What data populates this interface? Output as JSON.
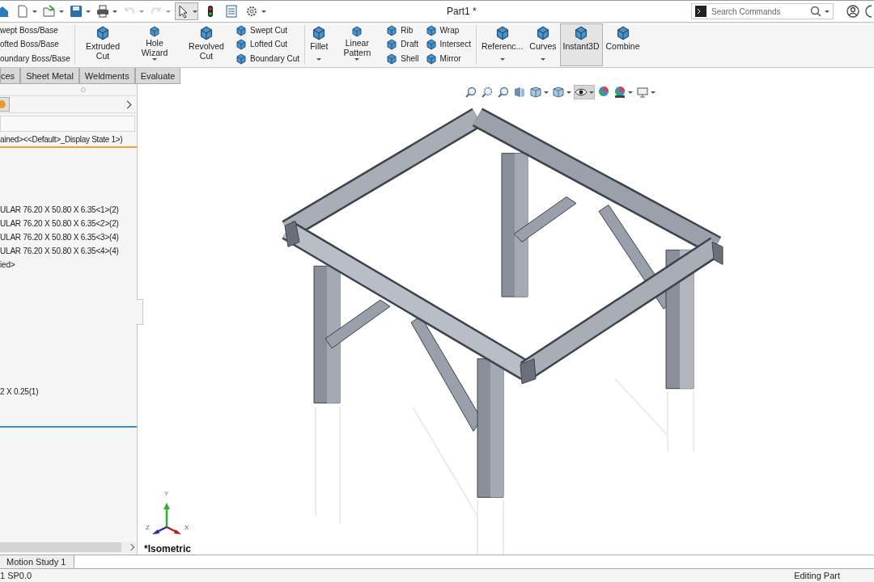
{
  "window": {
    "title": "Part1 *"
  },
  "quick_access": [
    {
      "kind": "home",
      "dropdown": false,
      "disabled": false,
      "selected": false
    },
    {
      "kind": "new",
      "dropdown": true,
      "disabled": false,
      "selected": false
    },
    {
      "kind": "open",
      "dropdown": true,
      "disabled": false,
      "selected": false
    },
    {
      "kind": "save",
      "dropdown": true,
      "disabled": false,
      "selected": false
    },
    {
      "kind": "print",
      "dropdown": true,
      "disabled": false,
      "selected": false
    },
    {
      "kind": "undo",
      "dropdown": true,
      "disabled": true,
      "selected": false
    },
    {
      "kind": "redo",
      "dropdown": true,
      "disabled": true,
      "selected": false
    },
    {
      "kind": "select",
      "dropdown": true,
      "disabled": false,
      "selected": true
    },
    {
      "kind": "rebuild",
      "dropdown": false,
      "disabled": false,
      "selected": false
    },
    {
      "kind": "properties",
      "dropdown": false,
      "disabled": false,
      "selected": false
    },
    {
      "kind": "options",
      "dropdown": true,
      "disabled": false,
      "selected": false
    }
  ],
  "search": {
    "placeholder": "Search Commands"
  },
  "ribbon": [
    {
      "kind": "stack",
      "items": [
        {
          "label": "wept Boss/Base",
          "icon": false
        },
        {
          "label": "ofted Boss/Base",
          "icon": false
        },
        {
          "label": "oundary Boss/Base",
          "icon": false
        }
      ]
    },
    {
      "kind": "separator"
    },
    {
      "kind": "large",
      "label": "Extruded Cut",
      "dropdown": false,
      "selected": false
    },
    {
      "kind": "large",
      "label": "Hole Wizard",
      "dropdown": true,
      "selected": false
    },
    {
      "kind": "large",
      "label": "Revolved Cut",
      "dropdown": false,
      "selected": false
    },
    {
      "kind": "stack",
      "items": [
        {
          "label": "Swept Cut",
          "icon": true
        },
        {
          "label": "Lofted Cut",
          "icon": true
        },
        {
          "label": "Boundary Cut",
          "icon": true
        }
      ]
    },
    {
      "kind": "separator"
    },
    {
      "kind": "large",
      "label": "Fillet",
      "dropdown": true,
      "selected": false
    },
    {
      "kind": "large",
      "label": "Linear Pattern",
      "dropdown": true,
      "selected": false
    },
    {
      "kind": "stack",
      "items": [
        {
          "label": "Rib",
          "icon": true
        },
        {
          "label": "Draft",
          "icon": true
        },
        {
          "label": "Shell",
          "icon": true
        }
      ]
    },
    {
      "kind": "stack",
      "items": [
        {
          "label": "Wrap",
          "icon": true
        },
        {
          "label": "Intersect",
          "icon": true
        },
        {
          "label": "Mirror",
          "icon": true
        }
      ]
    },
    {
      "kind": "separator"
    },
    {
      "kind": "large",
      "label": "Referenc...",
      "dropdown": true,
      "selected": false
    },
    {
      "kind": "large",
      "label": "Curves",
      "dropdown": true,
      "selected": false
    },
    {
      "kind": "large",
      "label": "Instant3D",
      "dropdown": false,
      "selected": true
    },
    {
      "kind": "large",
      "label": "Combine",
      "dropdown": false,
      "selected": false
    }
  ],
  "tabs": [
    {
      "label": "ces",
      "selected": false
    },
    {
      "label": "Sheet Metal",
      "selected": false
    },
    {
      "label": "Weldments",
      "selected": false
    },
    {
      "label": "Evaluate",
      "selected": false
    }
  ],
  "tree": {
    "header": {
      "label": "ained><<Default>_Display State 1>)",
      "selected": true
    },
    "items": [
      "ULAR 76.20 X 50.80 X 6.35<1>(2)",
      "ULAR 76.20 X 50.80 X 6.35<2>(2)",
      "ULAR 76.20 X 50.80 X 6.35<3>(4)",
      "ULAR 76.20 X 50.80 X 6.35<4>(4)",
      "ied>"
    ],
    "lower_item": "2 X 0.25(1)"
  },
  "view_toolbar": [
    {
      "kind": "zoom-fit",
      "selected": false,
      "dropdown": false
    },
    {
      "kind": "zoom-area",
      "selected": false,
      "dropdown": false
    },
    {
      "kind": "previous",
      "selected": false,
      "dropdown": false
    },
    {
      "kind": "section",
      "selected": false,
      "dropdown": false
    },
    {
      "kind": "orientation",
      "selected": false,
      "dropdown": true
    },
    {
      "kind": "display",
      "selected": false,
      "dropdown": true
    },
    {
      "kind": "hide-show",
      "selected": true,
      "dropdown": true
    },
    {
      "kind": "appearance",
      "selected": false,
      "dropdown": false
    },
    {
      "kind": "scene",
      "selected": false,
      "dropdown": true
    },
    {
      "kind": "monitor",
      "selected": false,
      "dropdown": true
    }
  ],
  "triad": {
    "x": "X",
    "y": "Y",
    "z": "Z"
  },
  "view_label": "*Isometric",
  "bottom_tabs": [
    {
      "label": "Motion Study 1",
      "selected": false
    }
  ],
  "status_bar": {
    "left": "1 SP0.0",
    "right": "Editing Part"
  }
}
